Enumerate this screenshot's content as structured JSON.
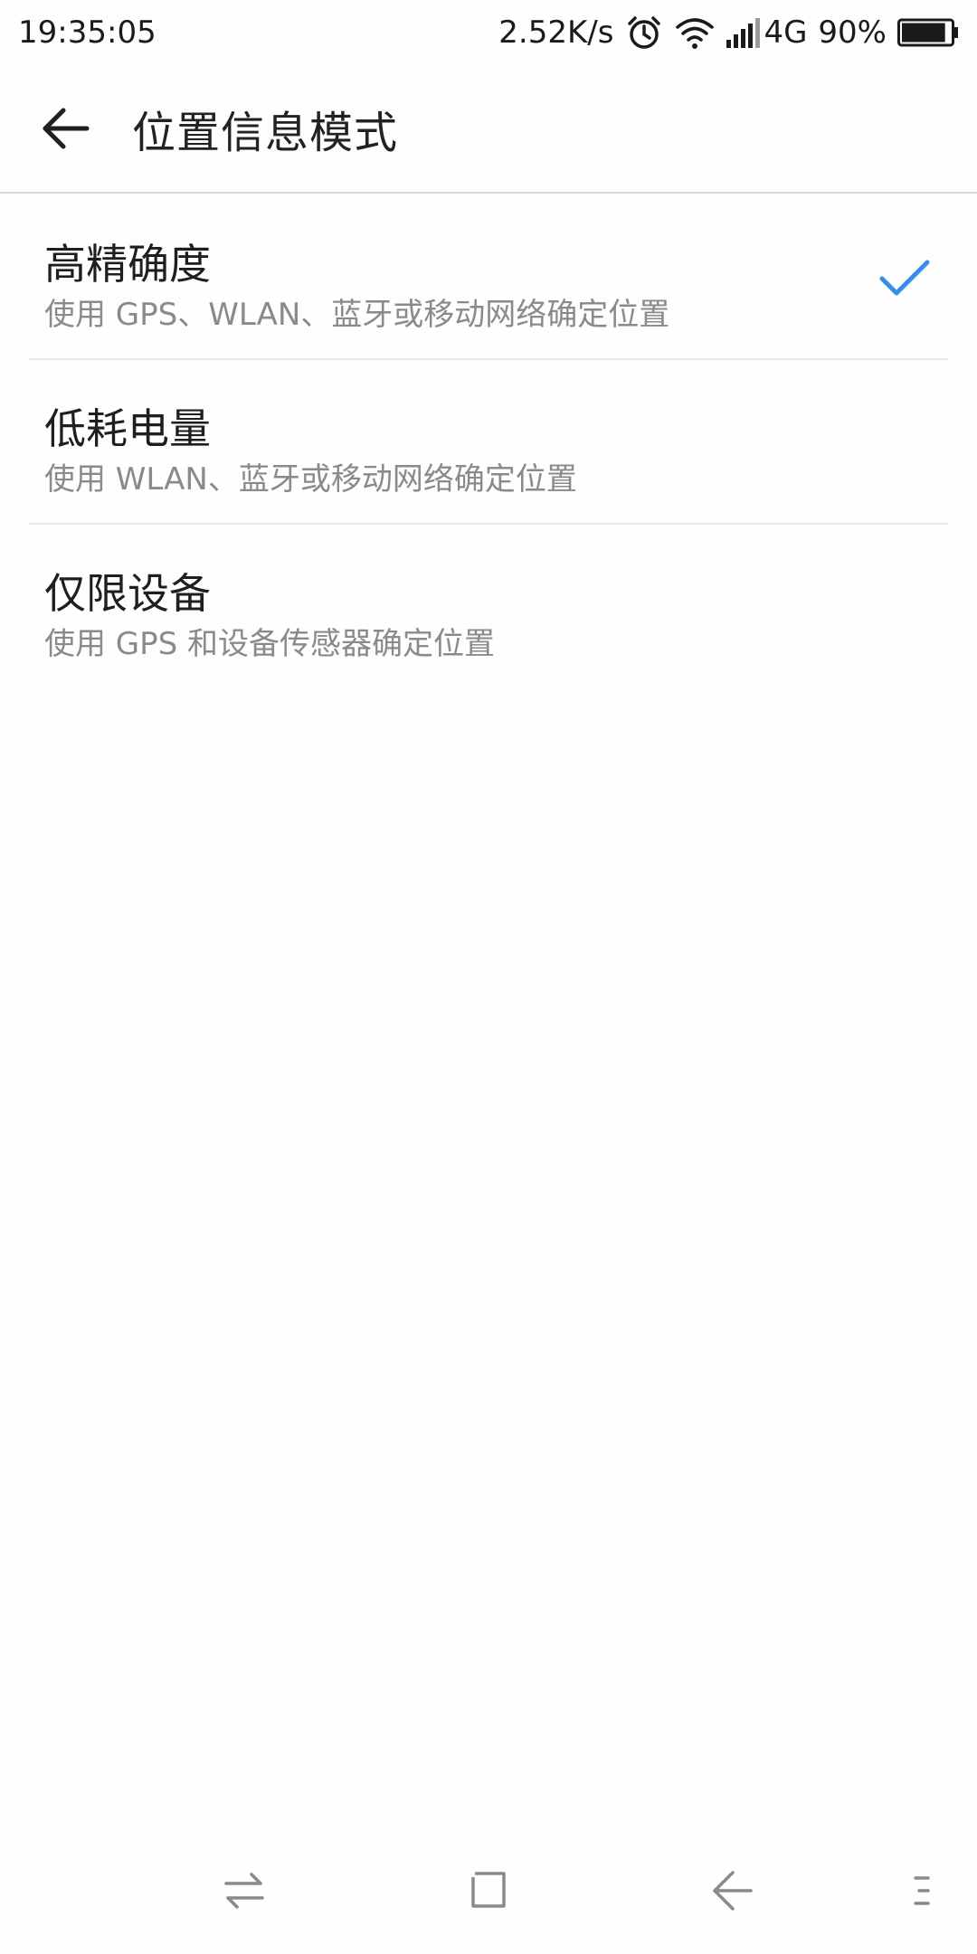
{
  "status_bar": {
    "time": "19:35:05",
    "net_speed": "2.52K/s",
    "network_type": "4G",
    "battery_percent": "90%",
    "battery_level": 0.9,
    "icons": [
      "alarm-icon",
      "wifi-icon",
      "signal-icon",
      "battery-icon"
    ]
  },
  "header": {
    "title": "位置信息模式",
    "back_icon": "arrow-left-icon"
  },
  "modes": [
    {
      "title": "高精确度",
      "subtitle": "使用 GPS、WLAN、蓝牙或移动网络确定位置",
      "selected": true
    },
    {
      "title": "低耗电量",
      "subtitle": "使用 WLAN、蓝牙或移动网络确定位置",
      "selected": false
    },
    {
      "title": "仅限设备",
      "subtitle": "使用 GPS 和设备传感器确定位置",
      "selected": false
    }
  ],
  "nav_bar": {
    "icons": [
      "switch-arrows-icon",
      "home-square-icon",
      "back-chevron-icon",
      "menu-dots-icon"
    ]
  },
  "colors": {
    "accent": "#3b8ee8",
    "divider": "#e8e8e8",
    "subtitle": "#8a8a8a",
    "nav_icon": "#8a8a8a"
  }
}
